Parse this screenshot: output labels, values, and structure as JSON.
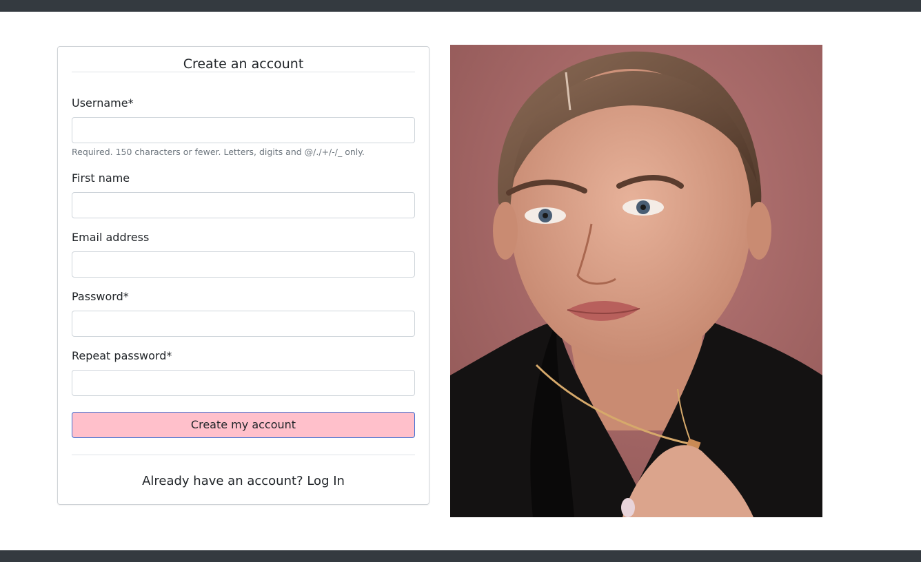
{
  "form": {
    "title": "Create an account",
    "username": {
      "label": "Username*",
      "value": "",
      "help": "Required. 150 characters or fewer. Letters, digits and @/./+/-/_ only."
    },
    "first_name": {
      "label": "First name",
      "value": ""
    },
    "email": {
      "label": "Email address",
      "value": ""
    },
    "password": {
      "label": "Password*",
      "value": ""
    },
    "repeat_password": {
      "label": "Repeat password*",
      "value": ""
    },
    "submit_label": "Create my account",
    "login_prompt": "Already have an account?",
    "login_link": "Log In"
  },
  "colors": {
    "header_bar": "#343a40",
    "submit_button": "#ffc0cb",
    "submit_border": "#3b6fd4",
    "photo_background": "#a76968"
  }
}
